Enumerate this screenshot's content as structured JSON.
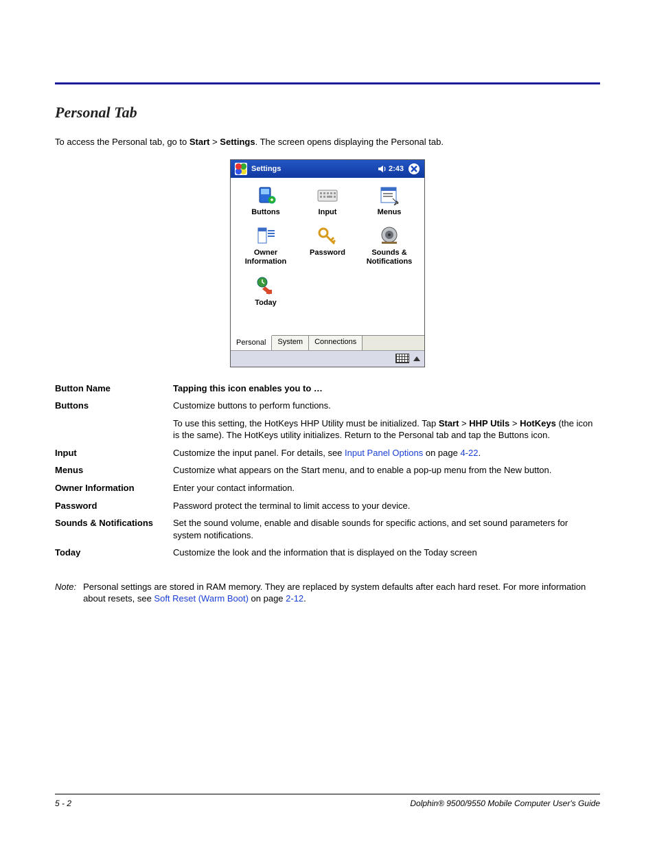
{
  "section_title": "Personal Tab",
  "intro": {
    "pre": "To access the Personal tab, go to ",
    "b1": "Start",
    "sep": " > ",
    "b2": "Settings",
    "post": ". The screen opens displaying the Personal tab."
  },
  "screenshot": {
    "title": "Settings",
    "time": "2:43",
    "icons": [
      {
        "label": "Buttons",
        "icon": "buttons-icon"
      },
      {
        "label": "Input",
        "icon": "keyboard-icon"
      },
      {
        "label": "Menus",
        "icon": "menus-icon"
      },
      {
        "label": "Owner Information",
        "icon": "owner-icon"
      },
      {
        "label": "Password",
        "icon": "key-icon"
      },
      {
        "label": "Sounds & Notifications",
        "icon": "speaker-app-icon"
      },
      {
        "label": "Today",
        "icon": "today-icon"
      }
    ],
    "tabs": [
      "Personal",
      "System",
      "Connections"
    ],
    "active_tab": 0
  },
  "table": {
    "header": {
      "name": "Button Name",
      "desc": "Tapping this icon enables you to …"
    },
    "rows": [
      {
        "name": "Buttons",
        "desc_parts": [
          {
            "text": "Customize buttons to perform functions."
          }
        ],
        "extra_parts": [
          {
            "text": "To use this setting, the HotKeys HHP Utility must be initialized. Tap "
          },
          {
            "bold": "Start"
          },
          {
            "text": " > "
          },
          {
            "bold": "HHP Utils"
          },
          {
            "text": " > "
          },
          {
            "bold": "HotKeys"
          },
          {
            "text": " (the icon is the same). The HotKeys utility initializes. Return to the Personal tab and tap the Buttons icon."
          }
        ]
      },
      {
        "name": "Input",
        "desc_parts": [
          {
            "text": "Customize the input panel. For details, see "
          },
          {
            "link": "Input Panel Options"
          },
          {
            "text": " on page "
          },
          {
            "link": "4-22"
          },
          {
            "text": "."
          }
        ]
      },
      {
        "name": "Menus",
        "desc_parts": [
          {
            "text": "Customize what appears on the Start menu, and to enable a pop-up menu from the New button."
          }
        ]
      },
      {
        "name": "Owner Information",
        "desc_parts": [
          {
            "text": "Enter your contact information."
          }
        ]
      },
      {
        "name": "Password",
        "desc_parts": [
          {
            "text": "Password protect the terminal to limit access to your device."
          }
        ]
      },
      {
        "name": "Sounds & Notifications",
        "desc_parts": [
          {
            "text": "Set the sound volume, enable and disable sounds for specific actions, and set sound parameters for system notifications."
          }
        ]
      },
      {
        "name": "Today",
        "desc_parts": [
          {
            "text": "Customize the look and the information that is displayed on the Today screen"
          }
        ]
      }
    ]
  },
  "note": {
    "label": "Note:",
    "parts": [
      {
        "text": "Personal settings are stored in RAM memory. They are replaced by system defaults after each hard reset. For more information about resets, see "
      },
      {
        "link": "Soft Reset (Warm Boot)"
      },
      {
        "text": " on page "
      },
      {
        "link": "2-12"
      },
      {
        "text": "."
      }
    ]
  },
  "footer": {
    "page": "5 - 2",
    "doc": "Dolphin® 9500/9550 Mobile Computer User's Guide"
  }
}
